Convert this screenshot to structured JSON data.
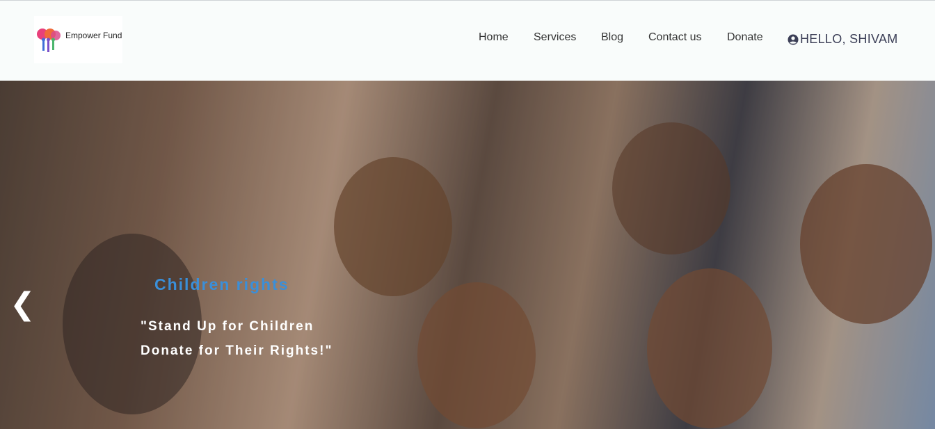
{
  "brand": {
    "name": "Empower Fund",
    "logo_icon": "hearts-people-logo"
  },
  "nav": {
    "items": [
      {
        "label": "Home"
      },
      {
        "label": "Services"
      },
      {
        "label": "Blog"
      },
      {
        "label": "Contact us"
      },
      {
        "label": "Donate"
      }
    ]
  },
  "user": {
    "greeting": "HELLO, SHIVAM",
    "icon": "user-circle-icon"
  },
  "hero": {
    "title": "Children rights",
    "quote_line1": "\"Stand Up for Children",
    "quote_line2": "Donate for Their Rights!\"",
    "prev_icon": "chevron-left-icon"
  },
  "colors": {
    "accent": "#3a8fd9",
    "header_bg": "#f9fcfb",
    "nav_text": "#333333",
    "user_text": "#3b3e56"
  }
}
